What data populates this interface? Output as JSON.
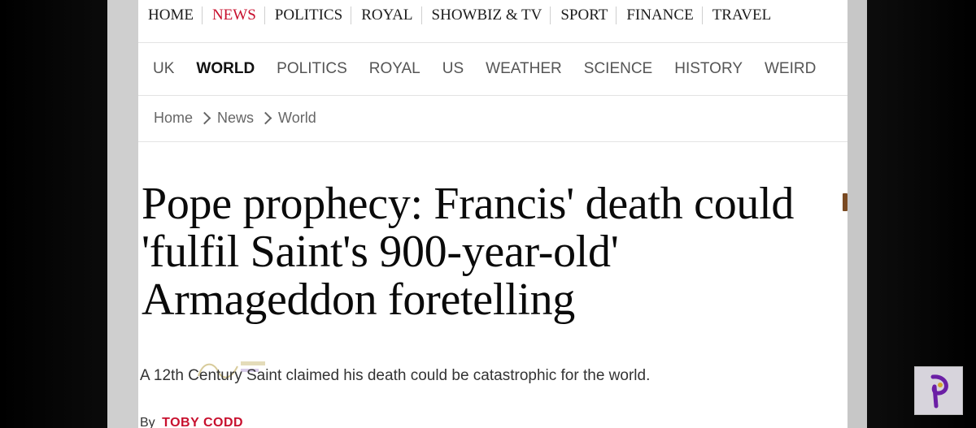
{
  "top_nav": {
    "items": [
      {
        "label": "HOME"
      },
      {
        "label": "NEWS"
      },
      {
        "label": "POLITICS"
      },
      {
        "label": "ROYAL"
      },
      {
        "label": "SHOWBIZ & TV"
      },
      {
        "label": "SPORT"
      },
      {
        "label": "FINANCE"
      },
      {
        "label": "TRAVEL"
      }
    ],
    "active": "NEWS",
    "active_color": "#c8102e"
  },
  "sub_nav": {
    "items": [
      {
        "label": "UK"
      },
      {
        "label": "WORLD"
      },
      {
        "label": "POLITICS"
      },
      {
        "label": "ROYAL"
      },
      {
        "label": "US"
      },
      {
        "label": "WEATHER"
      },
      {
        "label": "SCIENCE"
      },
      {
        "label": "HISTORY"
      },
      {
        "label": "WEIRD"
      }
    ],
    "active": "WORLD"
  },
  "breadcrumb": [
    "Home",
    "News",
    "World"
  ],
  "article": {
    "headline": "Pope prophecy: Francis' death could 'fulfil Saint's 900-year-old' Armageddon foretelling",
    "standfirst": "A 12th Century Saint claimed his death could be catastrophic for the world.",
    "byline_prefix": "By",
    "author": "TOBY CODD"
  },
  "icons": {
    "separator": "chevron-right-icon",
    "watermark": "watermark-logo",
    "channel": "channel-logo-icon"
  },
  "colors": {
    "accent": "#c8102e",
    "channel_logo": "#6b1fa5"
  }
}
